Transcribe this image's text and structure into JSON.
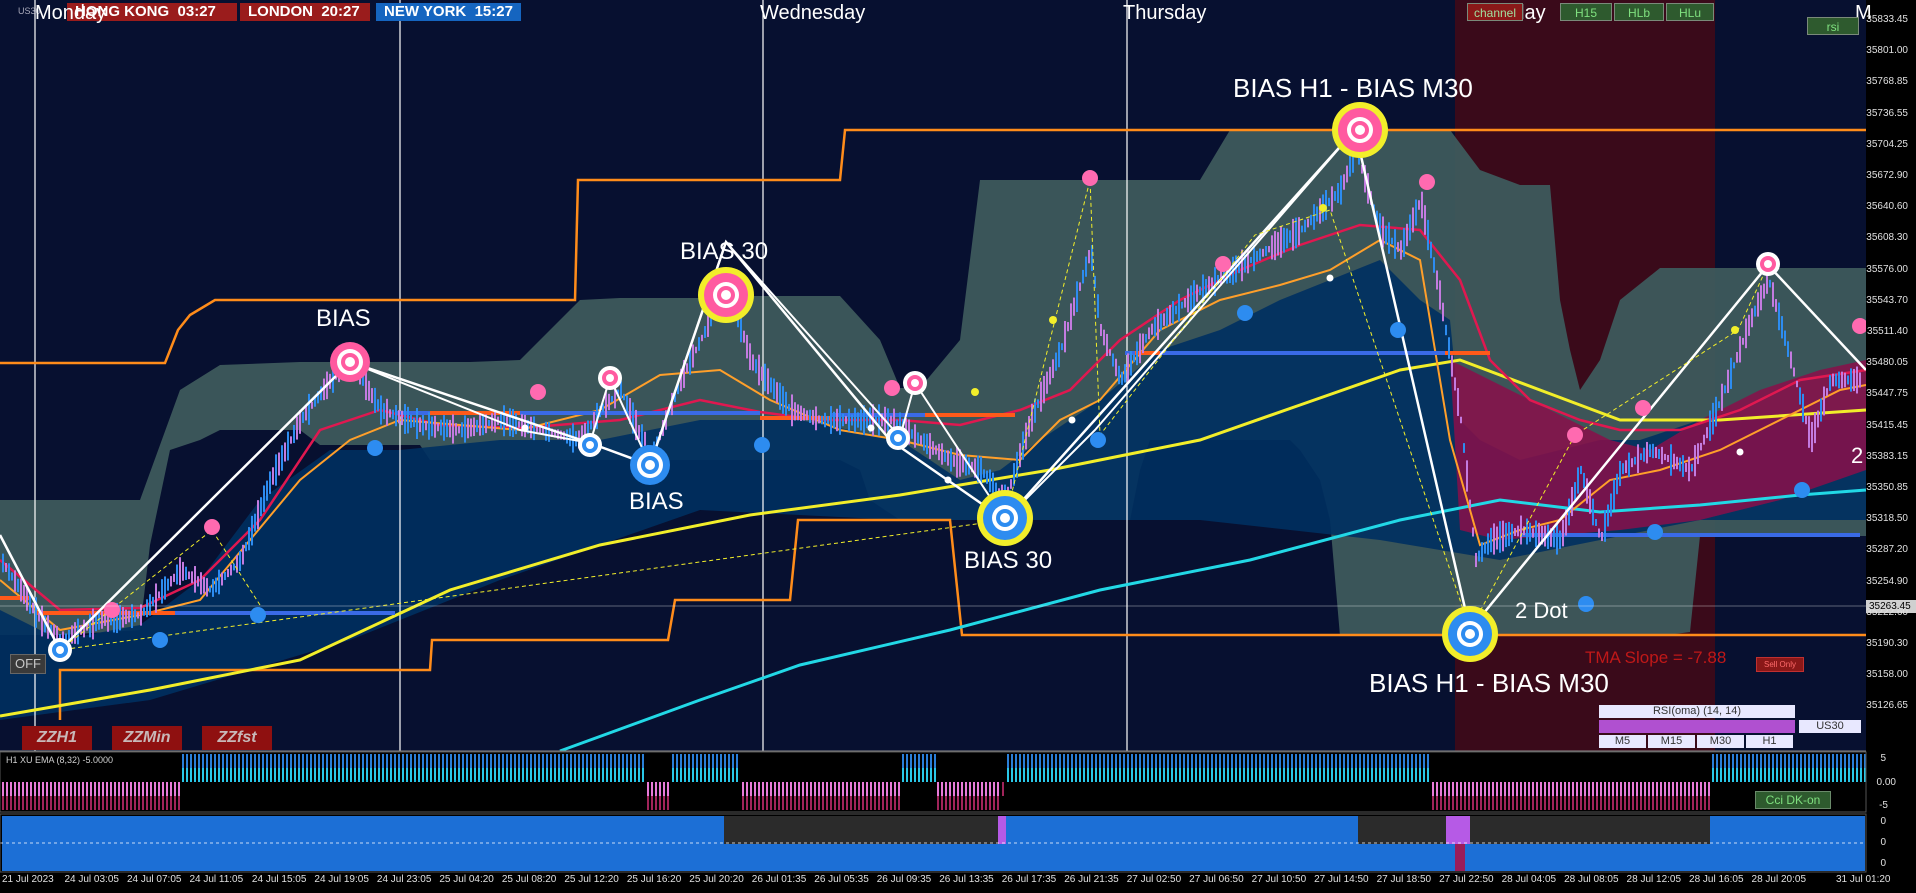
{
  "clocks": [
    {
      "label": "HONG KONG",
      "time": "03:27",
      "color": "#9a1c1c"
    },
    {
      "label": "LONDON",
      "time": "20:27",
      "color": "#9a1c1c"
    },
    {
      "label": "NEW YORK",
      "time": "15:27",
      "color": "#1565c0"
    }
  ],
  "days": [
    "Monday",
    "Wednesday",
    "Thursday",
    "Friday",
    "M"
  ],
  "symbol": "US30",
  "top_buttons": {
    "channel": "channel",
    "h15": "H15",
    "hlb": "HLb",
    "hlu": "HLu",
    "rsi": "rsi"
  },
  "labels": {
    "bias1": "BIAS",
    "bias30_top": "BIAS 30",
    "bias_low": "BIAS",
    "bias30_low": "BIAS 30",
    "bias_h1_top": "BIAS H1 - BIAS M30",
    "bias_h1_bottom": "BIAS H1 - BIAS M30",
    "two_dot": "2 Dot",
    "two_right": "2",
    "off": "OFF",
    "tma": "TMA Slope = -7.88",
    "tma_tag": "Sell Only"
  },
  "zz_buttons": [
    "ZZH1",
    "ZZMin",
    "ZZfst"
  ],
  "rsi_panel": {
    "title": "RSI(oma) (14, 14)",
    "symbol": "US30",
    "timeframes": [
      "M5",
      "M15",
      "M30",
      "H1"
    ]
  },
  "price_axis": [
    "35833.45",
    "35801.00",
    "35768.85",
    "35736.55",
    "35704.25",
    "35672.90",
    "35640.60",
    "35608.30",
    "35576.00",
    "35543.70",
    "35511.40",
    "35480.05",
    "35447.75",
    "35415.45",
    "35383.15",
    "35350.85",
    "35318.50",
    "35287.20",
    "35254.90",
    "35222.60",
    "35190.30",
    "35158.00",
    "35126.65"
  ],
  "current_price": "35263.45",
  "indicator1": {
    "title": "H1 XU EMA (8,32) -5.0000",
    "ticks": [
      "5",
      "0.00",
      "-5"
    ],
    "badge": "Cci DK-on"
  },
  "indicator2": {
    "ticks": [
      "0",
      "0",
      "0"
    ]
  },
  "date_axis": [
    "21 Jul 2023",
    "24 Jul 03:05",
    "24 Jul 07:05",
    "24 Jul 11:05",
    "24 Jul 15:05",
    "24 Jul 19:05",
    "24 Jul 23:05",
    "25 Jul 04:20",
    "25 Jul 08:20",
    "25 Jul 12:20",
    "25 Jul 16:20",
    "25 Jul 20:20",
    "26 Jul 01:35",
    "26 Jul 05:35",
    "26 Jul 09:35",
    "26 Jul 13:35",
    "26 Jul 17:35",
    "26 Jul 21:35",
    "27 Jul 02:50",
    "27 Jul 06:50",
    "27 Jul 10:50",
    "27 Jul 14:50",
    "27 Jul 18:50",
    "27 Jul 22:50",
    "28 Jul 04:05",
    "28 Jul 08:05",
    "28 Jul 12:05",
    "28 Jul 16:05",
    "28 Jul 20:05",
    "31 Jul 01:20"
  ],
  "colors": {
    "bg": "#071030",
    "band": "#3d5a5c",
    "channel": "#ff8c1a",
    "ema_yellow": "#f2ee2a",
    "ema_cyan": "#22d8e6",
    "tma_red": "#e01850",
    "zigzag": "#ffffff",
    "bull": "#2d8cf0",
    "bear": "#c37be0",
    "session": "#3a0a1a"
  }
}
